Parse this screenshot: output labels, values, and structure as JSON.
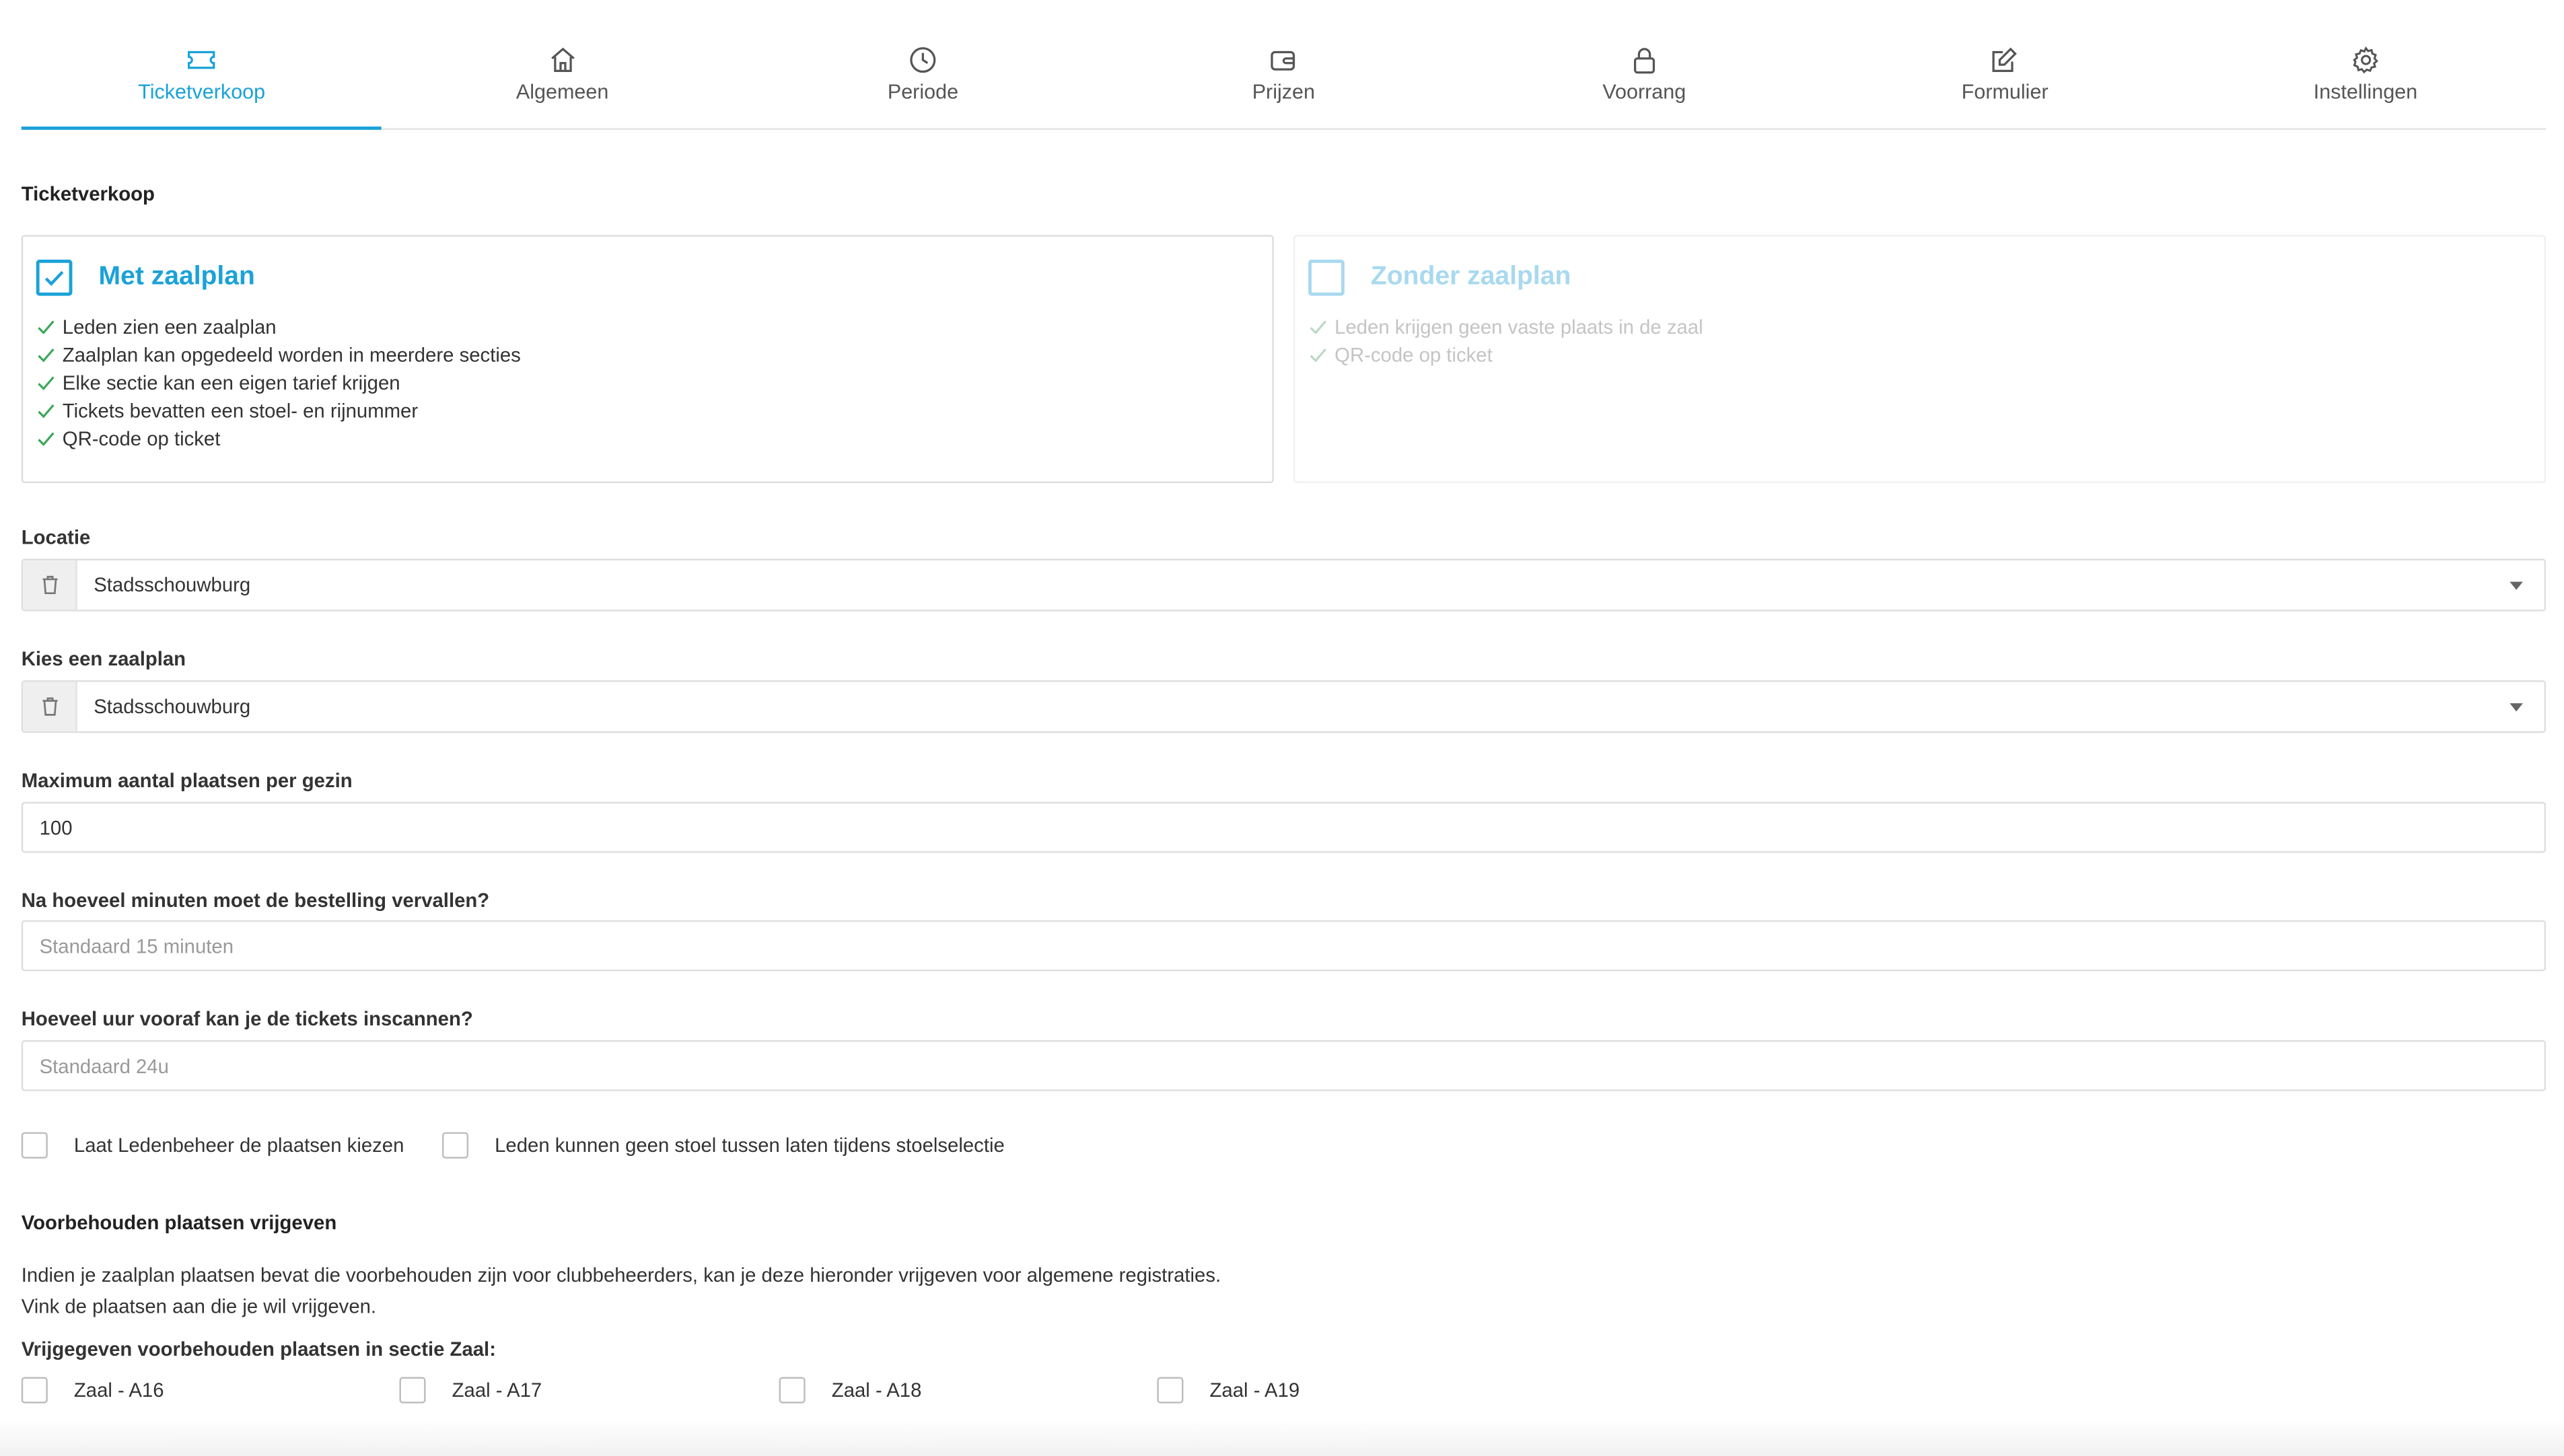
{
  "tabs": [
    {
      "label": "Ticketverkoop",
      "icon": "ticket-icon",
      "active": true
    },
    {
      "label": "Algemeen",
      "icon": "home-icon",
      "active": false
    },
    {
      "label": "Periode",
      "icon": "clock-icon",
      "active": false
    },
    {
      "label": "Prijzen",
      "icon": "wallet-icon",
      "active": false
    },
    {
      "label": "Voorrang",
      "icon": "lock-icon",
      "active": false
    },
    {
      "label": "Formulier",
      "icon": "edit-icon",
      "active": false
    },
    {
      "label": "Instellingen",
      "icon": "gear-icon",
      "active": false
    }
  ],
  "ticketverkoop": {
    "title": "Ticketverkoop",
    "options": [
      {
        "title": "Met zaalplan",
        "checked": true,
        "features": [
          "Leden zien een zaalplan",
          "Zaalplan kan opgedeeld worden in meerdere secties",
          "Elke sectie kan een eigen tarief krijgen",
          "Tickets bevatten een stoel- en rijnummer",
          "QR-code op ticket"
        ]
      },
      {
        "title": "Zonder zaalplan",
        "checked": false,
        "features": [
          "Leden krijgen geen vaste plaats in de zaal",
          "QR-code op ticket"
        ]
      }
    ]
  },
  "locatie": {
    "label": "Locatie",
    "value": "Stadsschouwburg"
  },
  "zaalplan": {
    "label": "Kies een zaalplan",
    "value": "Stadsschouwburg"
  },
  "max_plaatsen": {
    "label": "Maximum aantal plaatsen per gezin",
    "value": "100"
  },
  "vervallen": {
    "label": "Na hoeveel minuten moet de bestelling vervallen?",
    "placeholder": "Standaard 15 minuten"
  },
  "inscannen": {
    "label": "Hoeveel uur vooraf kan je de tickets inscannen?",
    "placeholder": "Standaard 24u"
  },
  "checkboxes": {
    "ledenbeheer": "Laat Ledenbeheer de plaatsen kiezen",
    "geen_stoel": "Leden kunnen geen stoel tussen laten tijdens stoelselectie"
  },
  "voorbehouden": {
    "title": "Voorbehouden plaatsen vrijgeven",
    "line1": "Indien je zaalplan plaatsen bevat die voorbehouden zijn voor clubbeheerders, kan je deze hieronder vrijgeven voor algemene registraties.",
    "line2": "Vink de plaatsen aan die je wil vrijgeven.",
    "section_label": "Vrijgegeven voorbehouden plaatsen in sectie Zaal:",
    "seats": [
      "Zaal - A16",
      "Zaal - A17",
      "Zaal - A18",
      "Zaal - A19"
    ]
  },
  "colors": {
    "accent": "#1ba2d8",
    "check_green": "#3aa757",
    "accent_light": "#a9d9ef"
  }
}
